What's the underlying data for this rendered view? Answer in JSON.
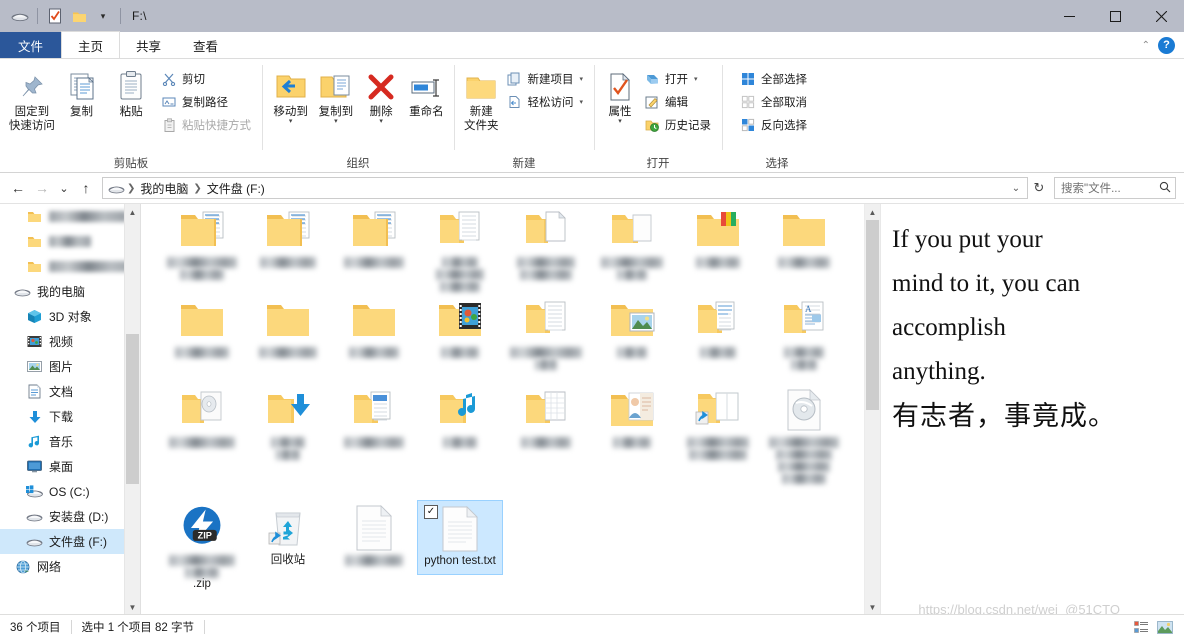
{
  "titlebar": {
    "path": "F:\\",
    "qat": [
      {
        "name": "drive-icon",
        "glyph": "drive"
      },
      {
        "name": "properties-check-icon",
        "glyph": "checkdoc"
      },
      {
        "name": "new-folder-icon",
        "glyph": "folder"
      },
      {
        "name": "customize-qat-caret",
        "glyph": "▾"
      }
    ],
    "window_controls": [
      {
        "name": "minimize-button",
        "glyph": "—"
      },
      {
        "name": "maximize-button",
        "glyph": "❐"
      },
      {
        "name": "close-button",
        "glyph": "✕"
      }
    ]
  },
  "tabs": [
    {
      "label": "文件",
      "kind": "file"
    },
    {
      "label": "主页",
      "kind": "active"
    },
    {
      "label": "共享",
      "kind": "normal"
    },
    {
      "label": "查看",
      "kind": "normal"
    }
  ],
  "tabstrip_right": {
    "collapse_ribbon": "⌃",
    "help": "?"
  },
  "ribbon": {
    "groups": [
      {
        "label": "剪贴板",
        "big": [
          {
            "label": "固定到\n快速访问",
            "icon": "pin-icon"
          },
          {
            "label": "复制",
            "icon": "copy-icon"
          },
          {
            "label": "粘贴",
            "icon": "paste-icon"
          }
        ],
        "small": [
          {
            "label": "剪切",
            "icon": "scissors-icon",
            "disabled": false
          },
          {
            "label": "复制路径",
            "icon": "copy-path-icon",
            "disabled": false
          },
          {
            "label": "粘贴快捷方式",
            "icon": "paste-shortcut-icon",
            "disabled": true
          }
        ]
      },
      {
        "label": "组织",
        "big": [
          {
            "label": "移动到",
            "icon": "move-to-icon",
            "caret": true
          },
          {
            "label": "复制到",
            "icon": "copy-to-icon",
            "caret": true
          },
          {
            "label": "删除",
            "icon": "delete-icon",
            "caret": true
          },
          {
            "label": "重命名",
            "icon": "rename-icon"
          }
        ],
        "small": []
      },
      {
        "label": "新建",
        "big": [
          {
            "label": "新建\n文件夹",
            "icon": "new-folder-icon"
          }
        ],
        "small": [
          {
            "label": "新建项目",
            "icon": "new-item-icon",
            "dropdown": true
          },
          {
            "label": "轻松访问",
            "icon": "easy-access-icon",
            "dropdown": true
          }
        ]
      },
      {
        "label": "打开",
        "big": [
          {
            "label": "属性",
            "icon": "properties-icon",
            "caret": true
          }
        ],
        "small": [
          {
            "label": "打开",
            "icon": "open-icon",
            "dropdown": true
          },
          {
            "label": "编辑",
            "icon": "edit-icon"
          },
          {
            "label": "历史记录",
            "icon": "history-icon"
          }
        ]
      },
      {
        "label": "选择",
        "big": [],
        "small": [
          {
            "label": "全部选择",
            "icon": "select-all-icon"
          },
          {
            "label": "全部取消",
            "icon": "select-none-icon",
            "disabled": true
          },
          {
            "label": "反向选择",
            "icon": "invert-selection-icon"
          }
        ]
      }
    ]
  },
  "addressbar": {
    "back": "←",
    "forward": "→",
    "recent": "⌄",
    "up": "↑",
    "crumbs": [
      {
        "label": "我的电脑",
        "icon": "computer-icon"
      },
      {
        "label": "文件盘 (F:)",
        "icon": ""
      }
    ],
    "dropdown": "⌄",
    "refresh": "↻",
    "search_placeholder": "搜索\"文件...",
    "search_value": ""
  },
  "navpane": {
    "items": [
      {
        "label": "",
        "icon": "folder-icon",
        "blurred": true,
        "blur_width": 78,
        "indent": true
      },
      {
        "label": "",
        "icon": "folder-icon",
        "blurred": true,
        "blur_width": 42,
        "indent": true
      },
      {
        "label": "",
        "icon": "folder-icon",
        "blurred": true,
        "blur_width": 88,
        "indent": true
      },
      {
        "label": "我的电脑",
        "icon": "computer-icon",
        "blurred": false
      },
      {
        "label": "3D 对象",
        "icon": "3d-objects-icon",
        "blurred": false,
        "indent": true
      },
      {
        "label": "视频",
        "icon": "videos-icon",
        "blurred": false,
        "indent": true
      },
      {
        "label": "图片",
        "icon": "pictures-icon",
        "blurred": false,
        "indent": true
      },
      {
        "label": "文档",
        "icon": "documents-icon",
        "blurred": false,
        "indent": true
      },
      {
        "label": "下载",
        "icon": "downloads-icon",
        "blurred": false,
        "indent": true
      },
      {
        "label": "音乐",
        "icon": "music-icon",
        "blurred": false,
        "indent": true
      },
      {
        "label": "桌面",
        "icon": "desktop-icon",
        "blurred": false,
        "indent": true
      },
      {
        "label": "OS (C:)",
        "icon": "os-drive-icon",
        "blurred": false,
        "indent": true
      },
      {
        "label": "安装盘 (D:)",
        "icon": "drive-icon",
        "blurred": false,
        "indent": true
      },
      {
        "label": "文件盘 (F:)",
        "icon": "drive-icon",
        "blurred": false,
        "indent": true,
        "selected": true
      },
      {
        "label": "网络",
        "icon": "network-icon",
        "blurred": false
      }
    ]
  },
  "files": {
    "items": [
      {
        "name": "",
        "icon": "folder-doc",
        "blurred": true,
        "blur_widths": [
          70,
          44
        ],
        "col": 0,
        "row": 0
      },
      {
        "name": "",
        "icon": "folder-doc",
        "blurred": true,
        "blur_widths": [
          56
        ],
        "col": 1,
        "row": 0
      },
      {
        "name": "",
        "icon": "folder-doc",
        "blurred": true,
        "blur_widths": [
          60
        ],
        "col": 2,
        "row": 0
      },
      {
        "name": "",
        "icon": "folder-open-doc",
        "blurred": true,
        "blur_widths": [
          36,
          48,
          40
        ],
        "col": 3,
        "row": 0
      },
      {
        "name": "",
        "icon": "folder-open-file",
        "blurred": true,
        "blur_widths": [
          58,
          52
        ],
        "col": 4,
        "row": 0
      },
      {
        "name": "",
        "icon": "folder-open-plain",
        "blurred": true,
        "blur_widths": [
          62,
          30
        ],
        "col": 5,
        "row": 0
      },
      {
        "name": "",
        "icon": "folder-color",
        "blurred": true,
        "blur_widths": [
          44
        ],
        "col": 6,
        "row": 0
      },
      {
        "name": "",
        "icon": "folder-plain",
        "blurred": true,
        "blur_widths": [
          52
        ],
        "col": 7,
        "row": 0
      },
      {
        "name": "",
        "icon": "folder-plain",
        "blurred": true,
        "blur_widths": [
          54
        ],
        "col": 0,
        "row": 1
      },
      {
        "name": "",
        "icon": "folder-plain",
        "blurred": true,
        "blur_widths": [
          58
        ],
        "col": 1,
        "row": 1
      },
      {
        "name": "",
        "icon": "folder-plain",
        "blurred": true,
        "blur_widths": [
          50
        ],
        "col": 2,
        "row": 1
      },
      {
        "name": "",
        "icon": "folder-film",
        "blurred": true,
        "blur_widths": [
          38
        ],
        "col": 3,
        "row": 1
      },
      {
        "name": "",
        "icon": "folder-open-doc",
        "blurred": true,
        "blur_widths": [
          72,
          22
        ],
        "col": 4,
        "row": 1
      },
      {
        "name": "",
        "icon": "folder-picture",
        "blurred": true,
        "blur_widths": [
          30
        ],
        "col": 5,
        "row": 1
      },
      {
        "name": "",
        "icon": "folder-open-doc2",
        "blurred": true,
        "blur_widths": [
          36
        ],
        "col": 6,
        "row": 1
      },
      {
        "name": "",
        "icon": "folder-open-article",
        "blurred": true,
        "blur_widths": [
          40,
          26
        ],
        "col": 7,
        "row": 1
      },
      {
        "name": "",
        "icon": "folder-open-disc",
        "blurred": true,
        "blur_widths": [
          66
        ],
        "col": 0,
        "row": 2
      },
      {
        "name": "",
        "icon": "folder-download",
        "blurred": true,
        "blur_widths": [
          34,
          24
        ],
        "col": 1,
        "row": 2
      },
      {
        "name": "",
        "icon": "folder-open-doc3",
        "blurred": true,
        "blur_widths": [
          60
        ],
        "col": 2,
        "row": 2
      },
      {
        "name": "",
        "icon": "folder-music",
        "blurred": true,
        "blur_widths": [
          34
        ],
        "col": 3,
        "row": 2
      },
      {
        "name": "",
        "icon": "folder-open-sheet",
        "blurred": true,
        "blur_widths": [
          50
        ],
        "col": 4,
        "row": 2
      },
      {
        "name": "",
        "icon": "folder-person",
        "blurred": true,
        "blur_widths": [
          38
        ],
        "col": 5,
        "row": 2
      },
      {
        "name": "",
        "icon": "folder-shortcut",
        "blurred": true,
        "blur_widths": [
          62,
          58
        ],
        "col": 6,
        "row": 2
      },
      {
        "name": "",
        "icon": "disc-file",
        "blurred": true,
        "blur_widths": [
          70,
          56,
          52,
          44
        ],
        "col": 7,
        "row": 2
      },
      {
        "name": ".zip",
        "icon": "zip-icon",
        "blurred": true,
        "blur_widths": [
          66,
          34
        ],
        "col": 0,
        "row": 3
      },
      {
        "name": "回收站",
        "icon": "recycle-bin-icon",
        "blurred": false,
        "col": 1,
        "row": 3
      },
      {
        "name": "",
        "icon": "text-file-icon",
        "blurred": true,
        "blur_widths": [
          58
        ],
        "col": 2,
        "row": 3
      },
      {
        "name": "python test.txt",
        "icon": "text-file-icon",
        "blurred": false,
        "selected": true,
        "checked": true,
        "col": 3,
        "row": 3
      }
    ]
  },
  "quote": {
    "lines": [
      "If you put your",
      "mind to it, you can",
      "accomplish",
      "anything."
    ],
    "cjk_line": "有志者，事竟成。",
    "watermark": "https://blog.csdn.net/wei_@51CTO"
  },
  "statusbar": {
    "count": "36 个项目",
    "selection": "选中 1 个项目  82 字节",
    "view_buttons": [
      {
        "name": "details-view-button",
        "glyph": "details"
      },
      {
        "name": "large-icons-view-button",
        "glyph": "icons"
      }
    ]
  },
  "colors": {
    "accent": "#2b579a",
    "titlebar": "#b8bcc8",
    "selection": "#cce8ff",
    "nav_selection": "#cfe8fb",
    "folder": "#ffd778"
  }
}
